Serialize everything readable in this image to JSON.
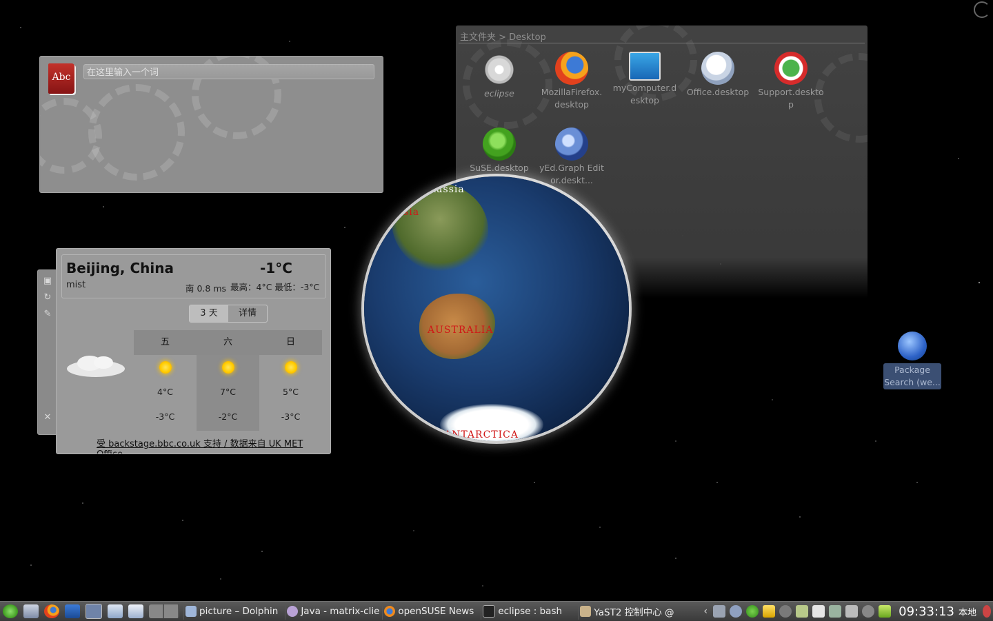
{
  "desktop": {
    "background": "#000000"
  },
  "dictionary": {
    "book_label": "Abc",
    "placeholder": "在这里输入一个词"
  },
  "folder_view": {
    "breadcrumb": "主文件夹 > Desktop",
    "icons": [
      {
        "label": "eclipse",
        "icon": "gear-icon"
      },
      {
        "label": "MozillaFirefox.desktop",
        "icon": "firefox-icon"
      },
      {
        "label": "myComputer.desktop",
        "icon": "computer-icon"
      },
      {
        "label": "Office.desktop",
        "icon": "office-icon"
      },
      {
        "label": "Support.desktop",
        "icon": "support-icon"
      },
      {
        "label": "SuSE.desktop",
        "icon": "suse-icon"
      },
      {
        "label": "yEd.Graph Editor.deskt...",
        "icon": "yed-icon"
      }
    ]
  },
  "globe": {
    "labels": {
      "russia": "Russia",
      "asia": "Asia",
      "australia": "AUSTRALIA",
      "antarctica": "ANTARCTICA"
    }
  },
  "weather": {
    "city": "Beijing, China",
    "temperature": "-1°C",
    "condition": "mist",
    "wind": "南 0.8 ms",
    "high_low": "最高：4°C 最低：-3°C",
    "tabs": [
      "3 天",
      "详情"
    ],
    "active_tab": "3 天",
    "forecast": [
      {
        "day": "五",
        "high": "4°C",
        "low": "-3°C",
        "icon": "sun-icon"
      },
      {
        "day": "六",
        "high": "7°C",
        "low": "-2°C",
        "icon": "sun-icon"
      },
      {
        "day": "日",
        "high": "5°C",
        "low": "-3°C",
        "icon": "sun-icon"
      }
    ],
    "credit": "受 backstage.bbc.co.uk 支持 / 数据来自 UK MET Office"
  },
  "package_search": {
    "label": "Package Search (we..."
  },
  "taskbar": {
    "tasks": [
      {
        "label": "picture – Dolphin"
      },
      {
        "label": "Java - matrix-clier"
      },
      {
        "label": "openSUSE News"
      },
      {
        "label": "eclipse : bash"
      },
      {
        "label": "YaST2 控制中心 @"
      }
    ],
    "clock": "09:33:13",
    "locale": "本地"
  }
}
